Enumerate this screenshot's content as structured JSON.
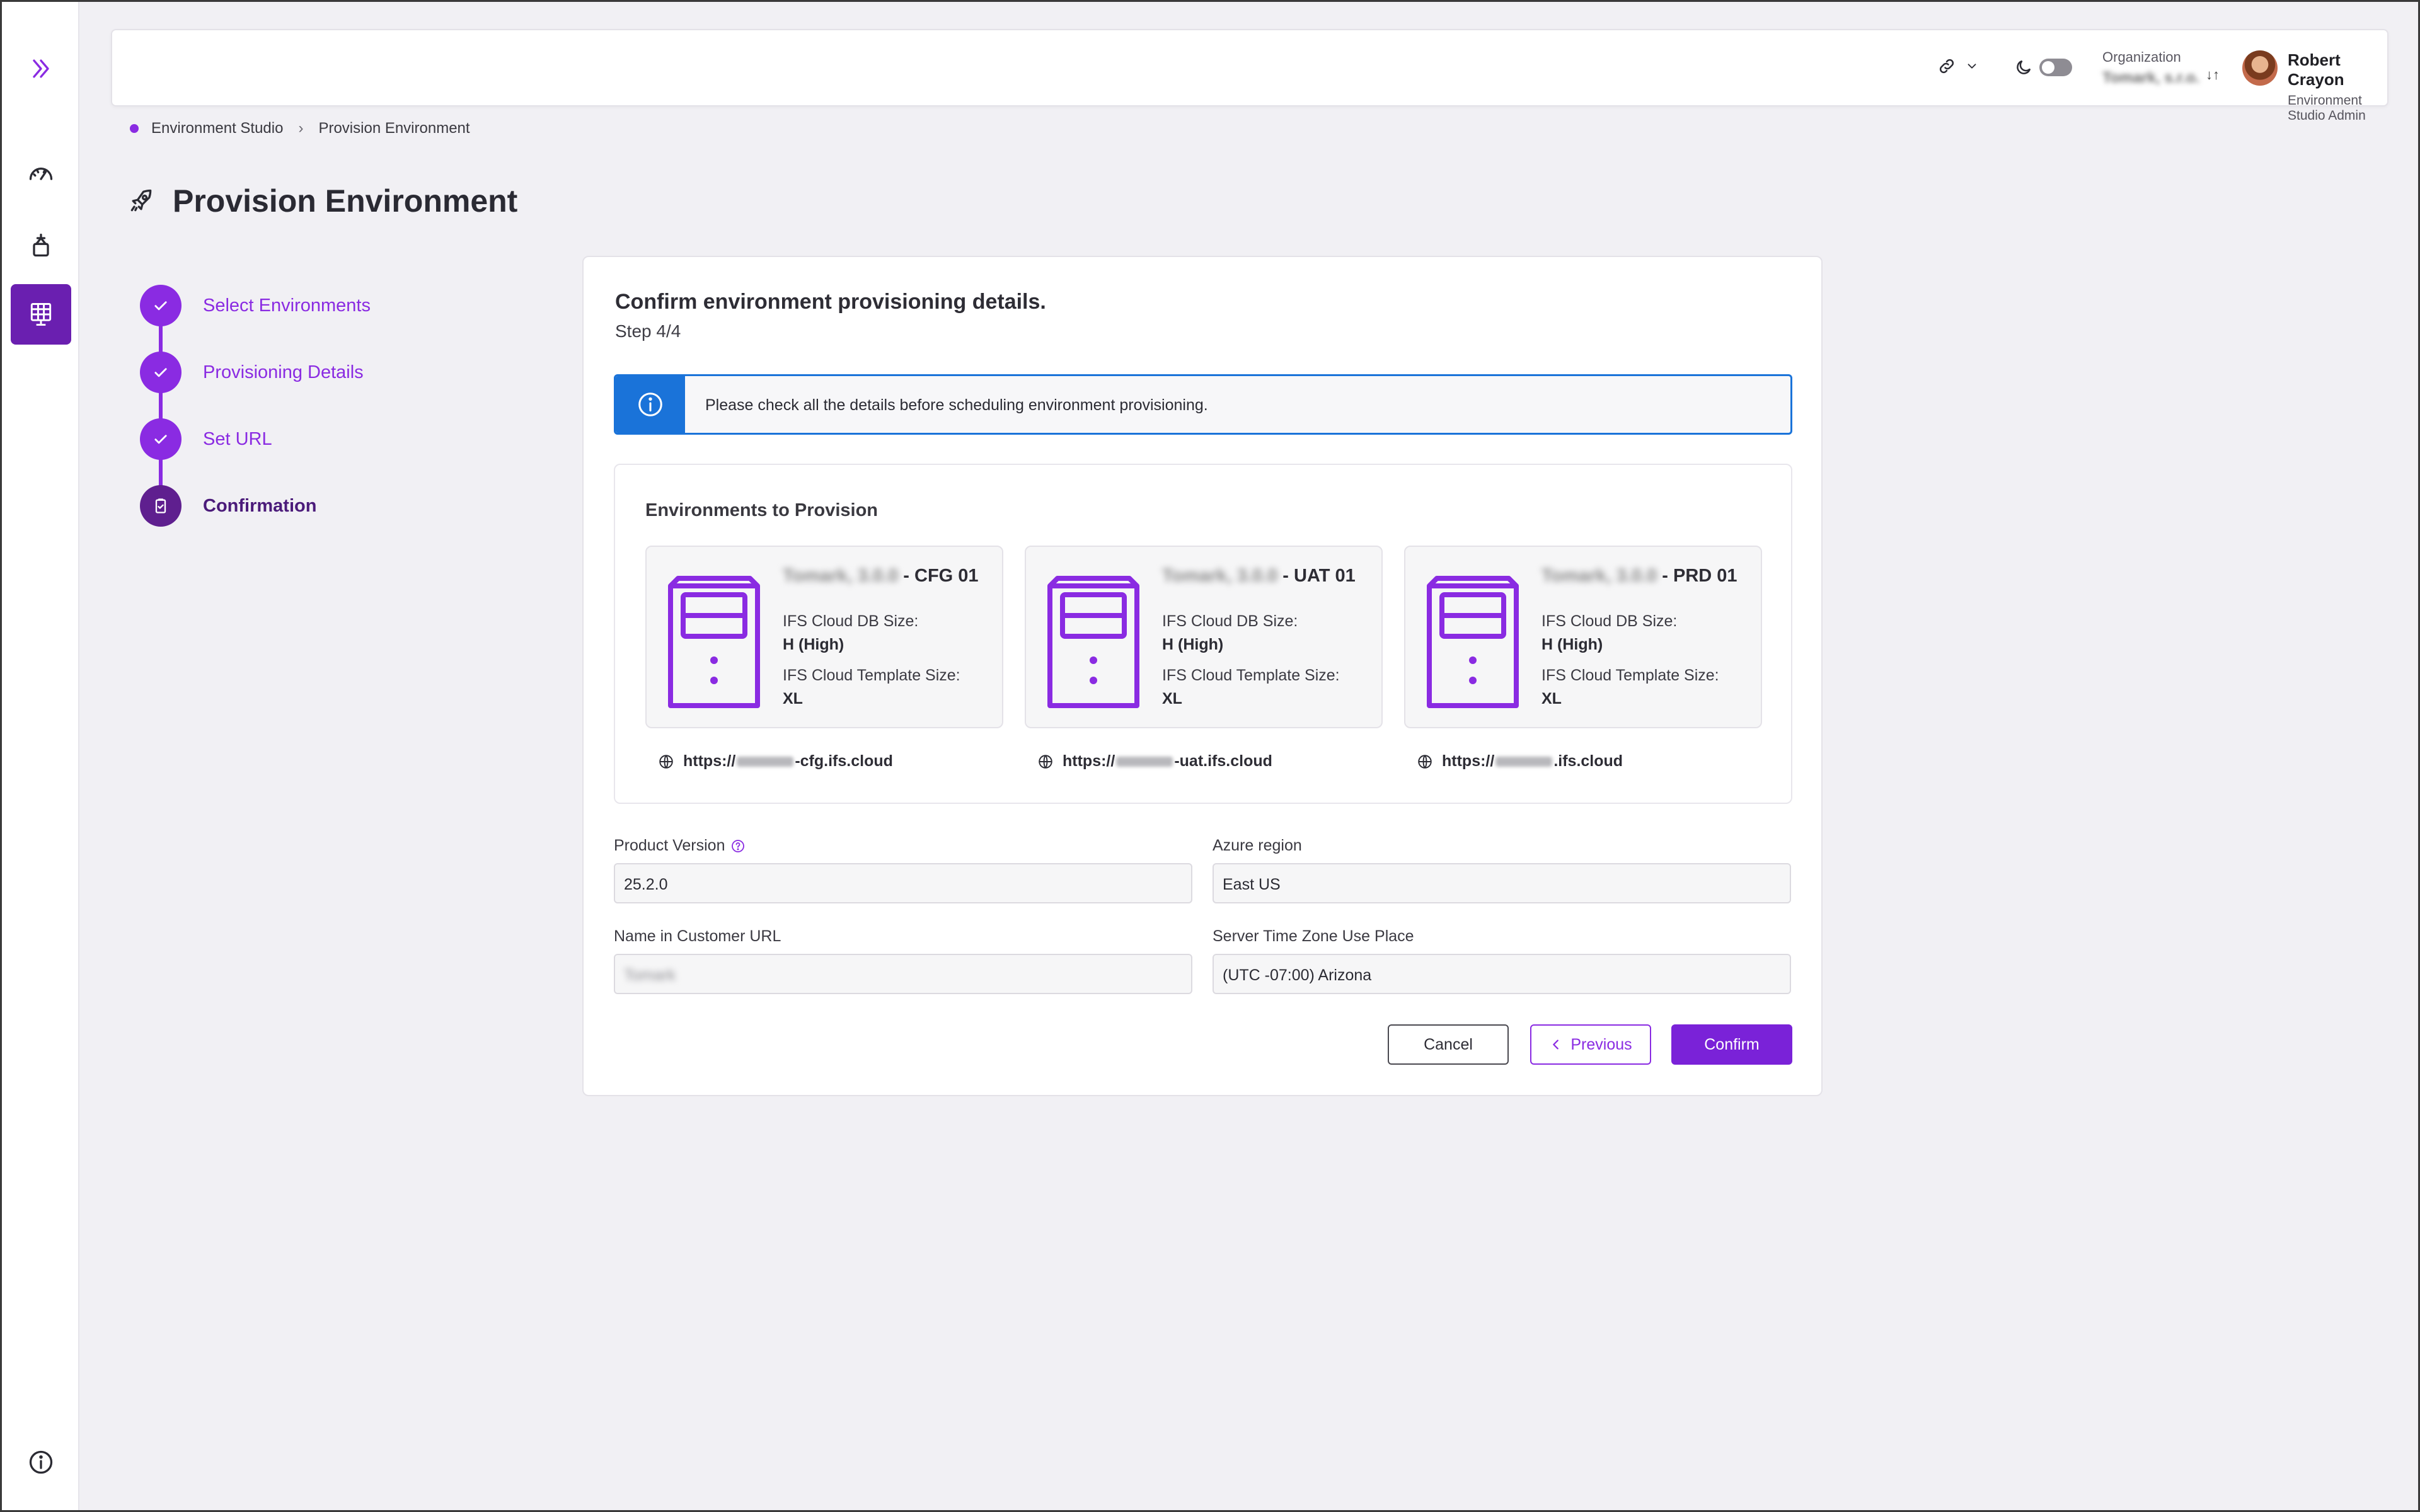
{
  "header": {
    "org_label": "Organization",
    "org_value": "Tomark, s.r.o.",
    "org_sort_glyph": "↓↑",
    "user_name": "Robert Crayon",
    "user_role": "Environment Studio Admin"
  },
  "breadcrumb": {
    "items": [
      "Environment Studio",
      "Provision Environment"
    ],
    "separator": "›"
  },
  "page": {
    "title": "Provision Environment"
  },
  "stepper": {
    "steps": [
      {
        "label": "Select Environments",
        "state": "completed"
      },
      {
        "label": "Provisioning Details",
        "state": "completed"
      },
      {
        "label": "Set URL",
        "state": "completed"
      },
      {
        "label": "Confirmation",
        "state": "current"
      }
    ]
  },
  "card": {
    "title": "Confirm environment provisioning details.",
    "step": "Step 4/4",
    "info_message": "Please check all the details before scheduling environment provisioning.",
    "env_section_title": "Environments to Provision",
    "environments": [
      {
        "name_prefix": "Tomark, 3.0.0",
        "name_suffix": "- CFG 01",
        "db_size_label": "IFS Cloud DB Size:",
        "db_size": "H (High)",
        "template_size_label": "IFS Cloud Template Size:",
        "template_size": "XL",
        "url_prefix": "https://",
        "url_suffix": "-cfg.ifs.cloud"
      },
      {
        "name_prefix": "Tomark, 3.0.0",
        "name_suffix": "- UAT 01",
        "db_size_label": "IFS Cloud DB Size:",
        "db_size": "H (High)",
        "template_size_label": "IFS Cloud Template Size:",
        "template_size": "XL",
        "url_prefix": "https://",
        "url_suffix": "-uat.ifs.cloud"
      },
      {
        "name_prefix": "Tomark, 3.0.0",
        "name_suffix": "- PRD 01",
        "db_size_label": "IFS Cloud DB Size:",
        "db_size": "H (High)",
        "template_size_label": "IFS Cloud Template Size:",
        "template_size": "XL",
        "url_prefix": "https://",
        "url_suffix": ".ifs.cloud"
      }
    ],
    "fields": {
      "product_version_label": "Product Version",
      "product_version": "25.2.0",
      "azure_region_label": "Azure region",
      "azure_region": "East US",
      "customer_url_label": "Name in Customer URL",
      "customer_url": "Tomark",
      "timezone_label": "Server Time Zone Use Place",
      "timezone": "(UTC -07:00) Arizona"
    },
    "buttons": {
      "cancel": "Cancel",
      "previous": "Previous",
      "confirm": "Confirm"
    }
  },
  "colors": {
    "accent": "#8a2be2",
    "accent_dark": "#5f1f8f",
    "info_blue": "#1a73d9",
    "background": "#f1f0f4"
  }
}
